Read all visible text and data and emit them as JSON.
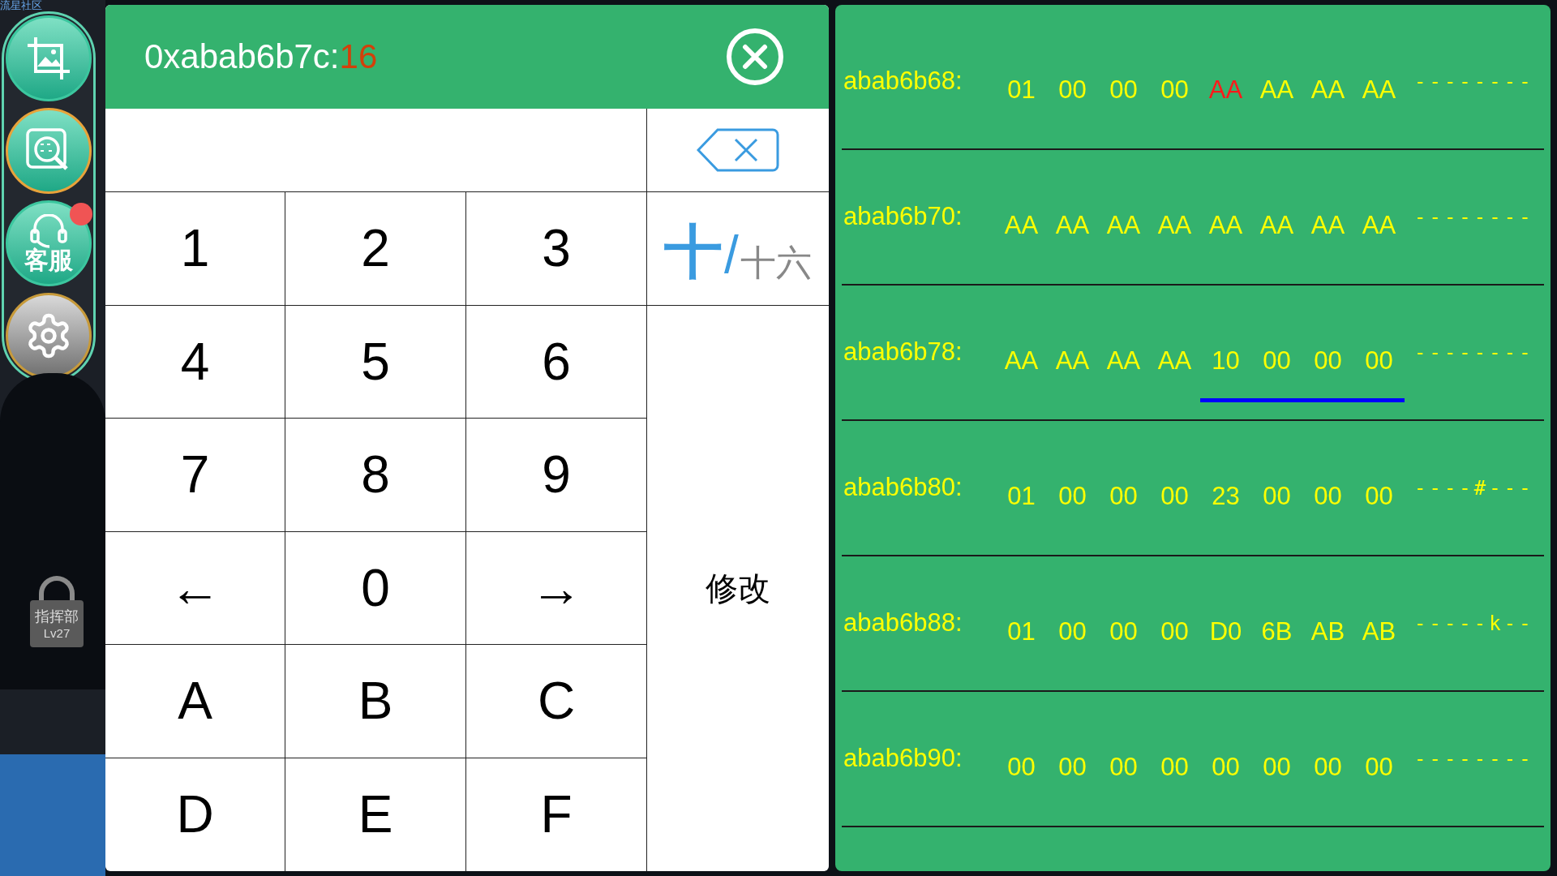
{
  "background": {
    "corner_text": "流星社区",
    "lock_badge": {
      "title": "指挥部",
      "level": "Lv27"
    }
  },
  "side_buttons": [
    {
      "kind": "screenshot",
      "badge": false
    },
    {
      "kind": "memory",
      "badge": false
    },
    {
      "kind": "support",
      "label": "客服",
      "badge": true
    },
    {
      "kind": "settings",
      "badge": false
    }
  ],
  "keypad": {
    "title": "0xabab6b7c:",
    "size": "16",
    "keys": [
      "1",
      "2",
      "3",
      "4",
      "5",
      "6",
      "7",
      "8",
      "9",
      "←",
      "0",
      "→",
      "A",
      "B",
      "C",
      "D",
      "E",
      "F"
    ],
    "modes": [
      {
        "label": "十",
        "selected": true
      },
      {
        "label": "十六",
        "selected": false
      }
    ],
    "mode_separator": "/",
    "submit": "修改"
  },
  "hex_rows": [
    {
      "address": "abab6b68:",
      "bytes": [
        {
          "text": "01",
          "highlighted": false,
          "underlined": false
        },
        {
          "text": "00",
          "highlighted": false,
          "underlined": false
        },
        {
          "text": "00",
          "highlighted": false,
          "underlined": false
        },
        {
          "text": "00",
          "highlighted": false,
          "underlined": false
        },
        {
          "text": "AA",
          "highlighted": true,
          "underlined": false
        },
        {
          "text": "AA",
          "highlighted": false,
          "underlined": false
        },
        {
          "text": "AA",
          "highlighted": false,
          "underlined": false
        },
        {
          "text": "AA",
          "highlighted": false,
          "underlined": false
        }
      ],
      "ascii": "--------"
    },
    {
      "address": "abab6b70:",
      "bytes": [
        {
          "text": "AA",
          "highlighted": false,
          "underlined": false
        },
        {
          "text": "AA",
          "highlighted": false,
          "underlined": false
        },
        {
          "text": "AA",
          "highlighted": false,
          "underlined": false
        },
        {
          "text": "AA",
          "highlighted": false,
          "underlined": false
        },
        {
          "text": "AA",
          "highlighted": false,
          "underlined": false
        },
        {
          "text": "AA",
          "highlighted": false,
          "underlined": false
        },
        {
          "text": "AA",
          "highlighted": false,
          "underlined": false
        },
        {
          "text": "AA",
          "highlighted": false,
          "underlined": false
        }
      ],
      "ascii": "--------"
    },
    {
      "address": "abab6b78:",
      "bytes": [
        {
          "text": "AA",
          "highlighted": false,
          "underlined": false
        },
        {
          "text": "AA",
          "highlighted": false,
          "underlined": false
        },
        {
          "text": "AA",
          "highlighted": false,
          "underlined": false
        },
        {
          "text": "AA",
          "highlighted": false,
          "underlined": false
        },
        {
          "text": "10",
          "highlighted": false,
          "underlined": true
        },
        {
          "text": "00",
          "highlighted": false,
          "underlined": true
        },
        {
          "text": "00",
          "highlighted": false,
          "underlined": true
        },
        {
          "text": "00",
          "highlighted": false,
          "underlined": true
        }
      ],
      "ascii": "--------"
    },
    {
      "address": "abab6b80:",
      "bytes": [
        {
          "text": "01",
          "highlighted": false,
          "underlined": false
        },
        {
          "text": "00",
          "highlighted": false,
          "underlined": false
        },
        {
          "text": "00",
          "highlighted": false,
          "underlined": false
        },
        {
          "text": "00",
          "highlighted": false,
          "underlined": false
        },
        {
          "text": "23",
          "highlighted": false,
          "underlined": false
        },
        {
          "text": "00",
          "highlighted": false,
          "underlined": false
        },
        {
          "text": "00",
          "highlighted": false,
          "underlined": false
        },
        {
          "text": "00",
          "highlighted": false,
          "underlined": false
        }
      ],
      "ascii": "----#---"
    },
    {
      "address": "abab6b88:",
      "bytes": [
        {
          "text": "01",
          "highlighted": false,
          "underlined": false
        },
        {
          "text": "00",
          "highlighted": false,
          "underlined": false
        },
        {
          "text": "00",
          "highlighted": false,
          "underlined": false
        },
        {
          "text": "00",
          "highlighted": false,
          "underlined": false
        },
        {
          "text": "D0",
          "highlighted": false,
          "underlined": false
        },
        {
          "text": "6B",
          "highlighted": false,
          "underlined": false
        },
        {
          "text": "AB",
          "highlighted": false,
          "underlined": false
        },
        {
          "text": "AB",
          "highlighted": false,
          "underlined": false
        }
      ],
      "ascii": "-----k--"
    },
    {
      "address": "abab6b90:",
      "bytes": [
        {
          "text": "00",
          "highlighted": false,
          "underlined": false
        },
        {
          "text": "00",
          "highlighted": false,
          "underlined": false
        },
        {
          "text": "00",
          "highlighted": false,
          "underlined": false
        },
        {
          "text": "00",
          "highlighted": false,
          "underlined": false
        },
        {
          "text": "00",
          "highlighted": false,
          "underlined": false
        },
        {
          "text": "00",
          "highlighted": false,
          "underlined": false
        },
        {
          "text": "00",
          "highlighted": false,
          "underlined": false
        },
        {
          "text": "00",
          "highlighted": false,
          "underlined": false
        }
      ],
      "ascii": "--------"
    }
  ]
}
